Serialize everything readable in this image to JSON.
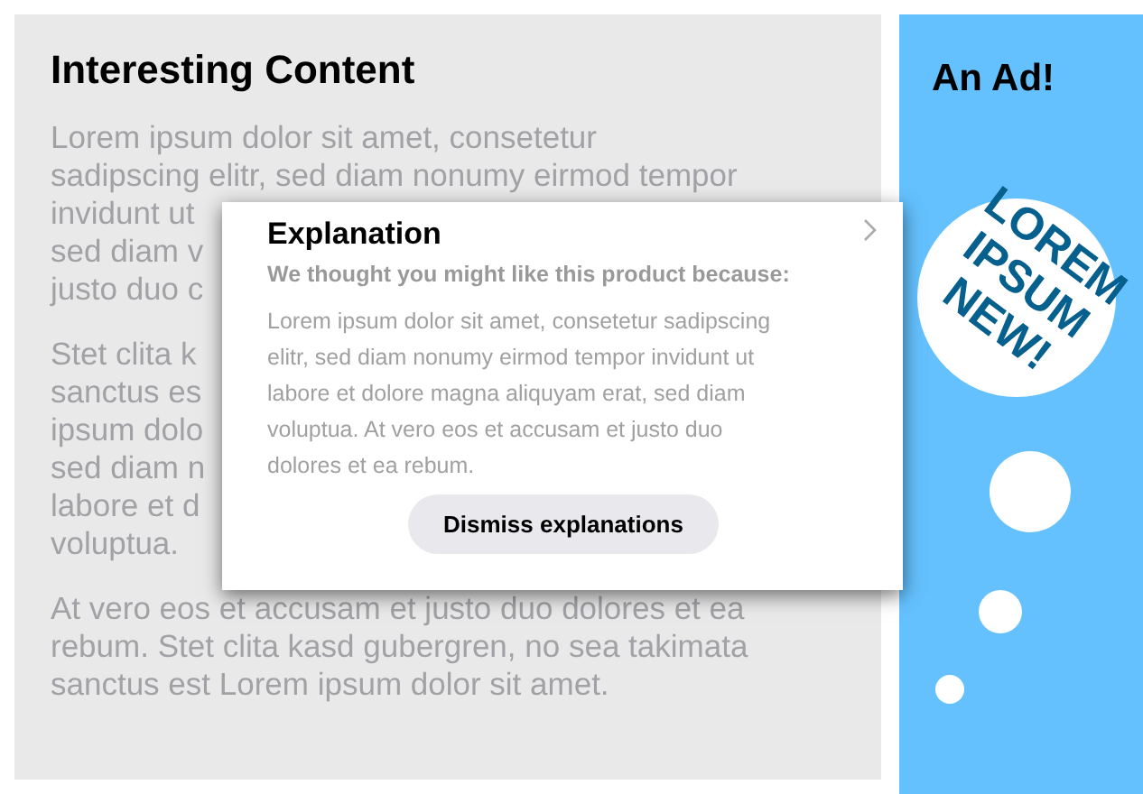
{
  "content": {
    "title": "Interesting Content",
    "paragraphs": [
      {
        "lines": [
          "Lorem ipsum dolor sit amet, consetetur",
          "sadipscing elitr, sed diam nonumy eirmod tempor",
          "invidunt ut",
          "sed diam v",
          "justo duo c"
        ]
      },
      {
        "lines": [
          "Stet clita k",
          "sanctus es",
          "ipsum dolo",
          "sed diam n",
          "labore et d",
          "voluptua."
        ]
      },
      {
        "lines": [
          "At vero eos et accusam et justo duo dolores et ea",
          "rebum. Stet clita kasd gubergren, no sea takimata",
          "sanctus est Lorem ipsum dolor sit amet."
        ]
      }
    ]
  },
  "popup": {
    "title": "Explanation",
    "subtitle": "We thought you might like this product because:",
    "body": "Lorem ipsum dolor sit amet, consetetur sadipscing elitr, sed diam nonumy eirmod tempor invidunt ut labore et dolore magna aliquyam erat, sed diam voluptua. At vero eos et accusam et justo duo dolores et ea rebum.",
    "button": "Dismiss explanations"
  },
  "ad": {
    "title": "An Ad!",
    "slogan_lines": [
      "LOREM",
      "IPSUM",
      "NEW!"
    ]
  }
}
